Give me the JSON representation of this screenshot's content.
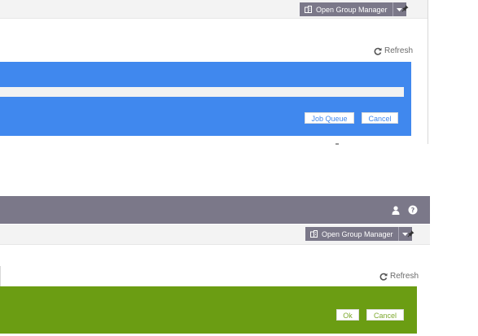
{
  "panel1": {
    "group_button": {
      "label": "Open Group Manager",
      "icon": "building-icon"
    },
    "refresh_label": "Refresh",
    "buttons": {
      "job_queue": "Job Queue",
      "cancel": "Cancel"
    },
    "colors": {
      "accent": "#4088ee"
    }
  },
  "panel2": {
    "group_button": {
      "label": "Open Group Manager",
      "icon": "building-icon"
    },
    "refresh_label": "Refresh",
    "buttons": {
      "ok": "Ok",
      "cancel": "Cancel"
    },
    "colors": {
      "header": "#7b7889",
      "accent": "#6b9d13"
    }
  }
}
